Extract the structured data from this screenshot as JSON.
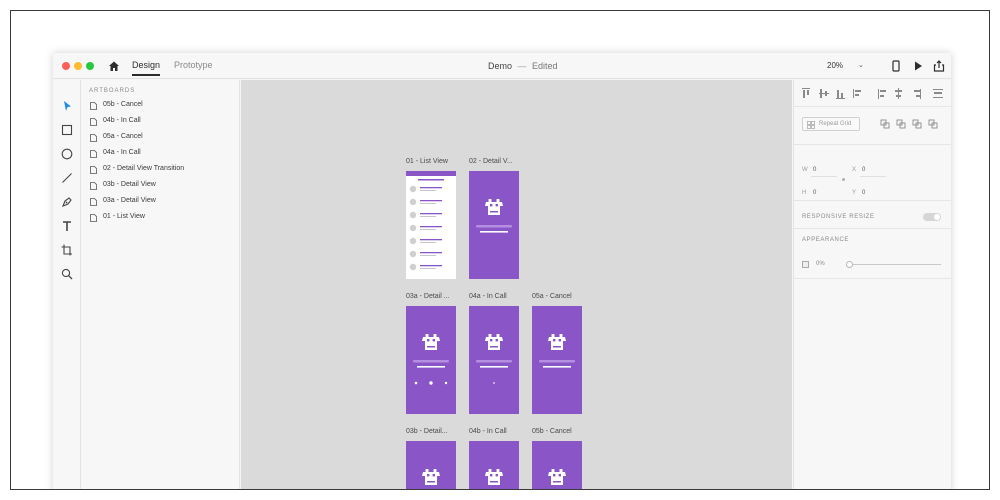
{
  "window": {
    "tabs": {
      "design": "Design",
      "prototype": "Prototype"
    },
    "doc_title": "Demo",
    "doc_sep": "—",
    "doc_status": "Edited",
    "zoom": "20%"
  },
  "layers": {
    "heading": "ARTBOARDS",
    "items": [
      "05b - Cancel",
      "04b - In Call",
      "05a - Cancel",
      "04a - In Call",
      "02 - Detail View Transition",
      "03b - Detail View",
      "03a - Detail View",
      "01 - List View"
    ]
  },
  "canvas": {
    "artboards": [
      {
        "label": "01 - List View",
        "kind": "list"
      },
      {
        "label": "02 - Detail V...",
        "kind": "detail"
      },
      {
        "label": "03a - Detail ...",
        "kind": "detail-call"
      },
      {
        "label": "04a - In Call",
        "kind": "in-call"
      },
      {
        "label": "05a - Cancel",
        "kind": "detail"
      },
      {
        "label": "03b - Detail...",
        "kind": "detail-call"
      },
      {
        "label": "04b - In Call",
        "kind": "in-call"
      },
      {
        "label": "05b - Cancel",
        "kind": "detail"
      }
    ]
  },
  "props": {
    "repeat_grid": "Repeat Grid",
    "w_label": "W",
    "w_value": "0",
    "h_label": "H",
    "h_value": "0",
    "x_label": "X",
    "x_value": "0",
    "y_label": "Y",
    "y_value": "0",
    "responsive_resize": "RESPONSIVE RESIZE",
    "appearance": "APPEARANCE",
    "opacity": "0%"
  },
  "colors": {
    "artboard_purple": "#8a55c6",
    "accent_blue": "#1f8ae8",
    "close": "#fc5f57",
    "minimize": "#fdbc2e",
    "maximize": "#28c840"
  },
  "icons": {
    "toolbar": [
      "select-icon",
      "rectangle-icon",
      "ellipse-icon",
      "line-icon",
      "pen-icon",
      "text-icon",
      "artboard-icon",
      "zoom-icon"
    ],
    "artboard_glyph": "cow-face-icon"
  }
}
